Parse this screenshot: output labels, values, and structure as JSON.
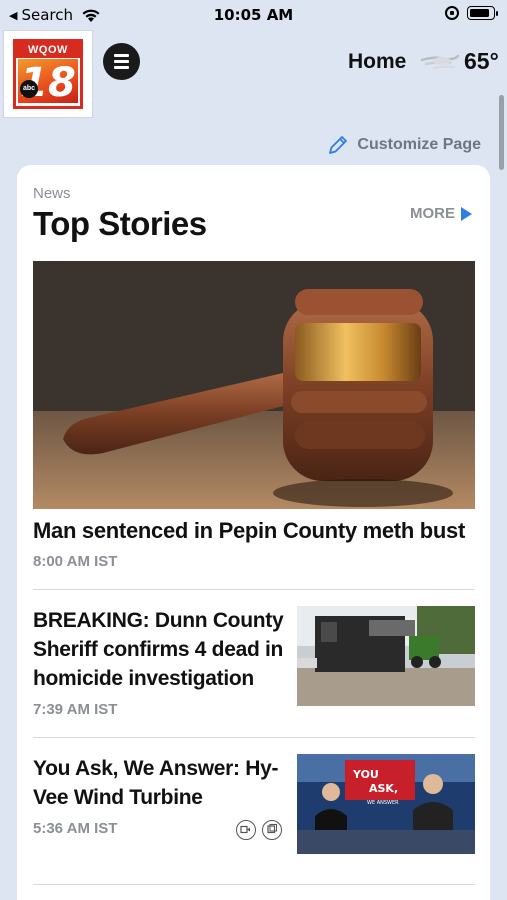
{
  "status_bar": {
    "back_label": "Search",
    "time": "10:05 AM"
  },
  "header": {
    "logo_station": "WQOW",
    "logo_number": "18",
    "logo_network": "abc",
    "home_label": "Home",
    "temperature": "65°"
  },
  "customize": {
    "label": "Customize Page"
  },
  "section": {
    "kicker": "News",
    "title": "Top Stories",
    "more_label": "MORE"
  },
  "hero_story": {
    "headline": "Man sentenced in Pepin County meth bust",
    "time": "8:00 AM IST"
  },
  "stories": [
    {
      "headline": "BREAKING: Dunn County Sheriff confirms 4 dead in homicide investigation",
      "time": "7:39 AM IST"
    },
    {
      "headline": "You Ask, We Answer: Hy-Vee Wind Turbine",
      "time": "5:36 AM IST",
      "thumb_text_1": "YOU",
      "thumb_text_2": "ASK,",
      "thumb_text_3": "WE ANSWER"
    }
  ],
  "colors": {
    "accent_blue": "#2f7ee6",
    "brand_red": "#d62b1e",
    "page_bg": "#dde5f2"
  }
}
